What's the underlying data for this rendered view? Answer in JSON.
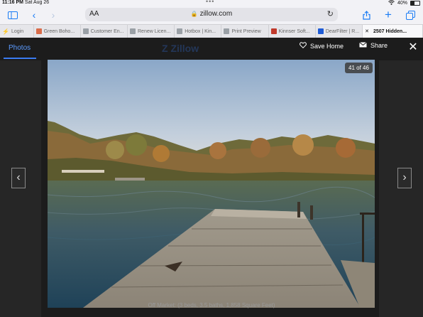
{
  "status": {
    "time": "11:16 PM",
    "date": "Sat Aug 26",
    "battery": "40%"
  },
  "browser": {
    "font_size_label": "AA",
    "url": "zillow.com",
    "tabs": [
      {
        "label": "Login",
        "color": "#2ecc71"
      },
      {
        "label": "Green Boho...",
        "color": "#d96c4a"
      },
      {
        "label": "Customer En...",
        "color": "#9aa0a6"
      },
      {
        "label": "Renew Licen...",
        "color": "#9aa0a6"
      },
      {
        "label": "Hotbox | Kin...",
        "color": "#9aa0a6"
      },
      {
        "label": "Print Preview",
        "color": "#9aa0a6"
      },
      {
        "label": "Kinnser Soft...",
        "color": "#c0392b"
      },
      {
        "label": "DearFilter | R...",
        "color": "#1e5bd6"
      },
      {
        "label": "2507 Hidden...",
        "color": "#333333"
      }
    ]
  },
  "viewer": {
    "photos_tab": "Photos",
    "logo": "Zillow",
    "save_home": "Save Home",
    "share": "Share",
    "counter": "41 of 46",
    "caption": "Off Market: (3 beds, 3.5 baths, 1,858 Square Feet)"
  }
}
